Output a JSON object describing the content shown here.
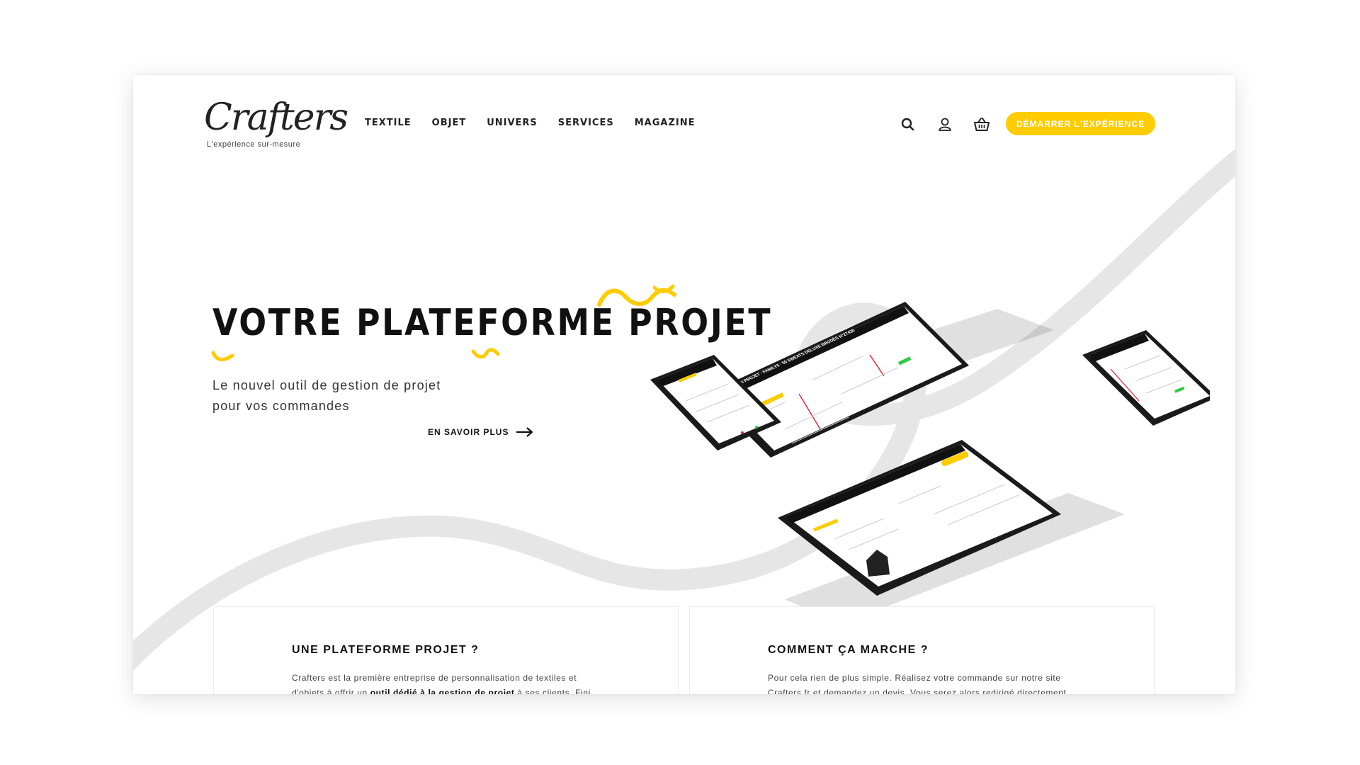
{
  "brand": {
    "logo_text": "Crafters",
    "tagline": "L'expérience sur-mesure"
  },
  "nav": {
    "items": [
      {
        "label": "TEXTILE"
      },
      {
        "label": "OBJET"
      },
      {
        "label": "UNIVERS"
      },
      {
        "label": "SERVICES"
      },
      {
        "label": "MAGAZINE"
      }
    ]
  },
  "header_icons": [
    "search-icon",
    "user-icon",
    "basket-icon"
  ],
  "cta": {
    "label": "DÉMARRER L'EXPÉRIENCE"
  },
  "hero": {
    "title": "VOTRE PLATEFORME PROJET",
    "subtitle_line1": "Le nouvel outil de gestion de projet",
    "subtitle_line2": "pour vos commandes",
    "more_label": "EN SAVOIR PLUS"
  },
  "devices": {
    "screen_header": "MON PROJET · FAMILY6 · 50 SWEATS DELUXE BRODÉS N°27430"
  },
  "cards": [
    {
      "title": "UNE PLATEFORME PROJET ?",
      "text_part1": "Crafters est la première entreprise de personnalisation de textiles et d'objets à offrir un ",
      "text_bold": "outil dédié à la gestion de projet",
      "text_part2": " à ses clients. Fini le"
    },
    {
      "title": "COMMENT ÇA MARCHE ?",
      "text_part1": "Pour cela rien de plus simple. Réalisez votre commande sur notre site Crafters.fr et demandez un devis. Vous serez alors redirigé directement sur",
      "text_bold": "",
      "text_part2": ""
    }
  ],
  "colors": {
    "accent": "#ffcc00",
    "swoosh": "#e6e6e6",
    "text": "#111111",
    "device_body": "#1a1a1a",
    "status_green": "#2ecc40",
    "status_red": "#e0202a"
  }
}
